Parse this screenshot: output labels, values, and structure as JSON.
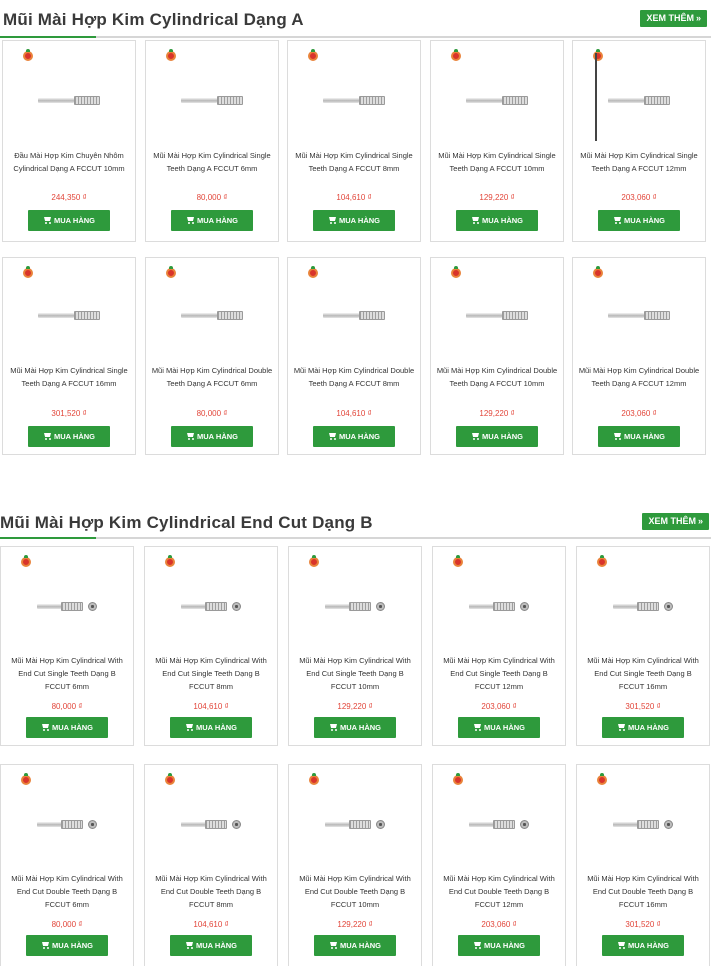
{
  "sections": [
    {
      "title": "Mũi Mài Hợp Kim Cylindrical Dạng A",
      "see_more": "XEM THÊM",
      "see_more_icon": "double-chevron-right",
      "products": [
        {
          "name": "Đầu Mài Hợp Kim Chuyên Nhôm Cylindrical Dạng A FCCUT 10mm",
          "price": "244,350 ₫",
          "buy": "MUA HÀNG"
        },
        {
          "name": "Mũi Mài Hợp Kim Cylindrical Single Teeth Dạng A FCCUT 6mm",
          "price": "80,000 ₫",
          "buy": "MUA HÀNG"
        },
        {
          "name": "Mũi Mài Hợp Kim Cylindrical Single Teeth Dạng A FCCUT 8mm",
          "price": "104,610 ₫",
          "buy": "MUA HÀNG"
        },
        {
          "name": "Mũi Mài Hợp Kim Cylindrical Single Teeth Dạng A FCCUT 10mm",
          "price": "129,220 ₫",
          "buy": "MUA HÀNG"
        },
        {
          "name": "Mũi Mài Hợp Kim Cylindrical Single Teeth Dạng A FCCUT 12mm",
          "price": "203,060 ₫",
          "buy": "MUA HÀNG"
        },
        {
          "name": "Mũi Mài Hợp Kim Cylindrical Single Teeth Dạng A FCCUT 16mm",
          "price": "301,520 ₫",
          "buy": "MUA HÀNG"
        },
        {
          "name": "Mũi Mài Hợp Kim Cylindrical Double Teeth Dạng A FCCUT 6mm",
          "price": "80,000 ₫",
          "buy": "MUA HÀNG"
        },
        {
          "name": "Mũi Mài Hợp Kim Cylindrical Double Teeth Dạng A FCCUT 8mm",
          "price": "104,610 ₫",
          "buy": "MUA HÀNG"
        },
        {
          "name": "Mũi Mài Hợp Kim Cylindrical Double Teeth Dạng A FCCUT 10mm",
          "price": "129,220 ₫",
          "buy": "MUA HÀNG"
        },
        {
          "name": "Mũi Mài Hợp Kim Cylindrical Double Teeth Dạng A FCCUT 12mm",
          "price": "203,060 ₫",
          "buy": "MUA HÀNG"
        }
      ]
    },
    {
      "title": "Mũi Mài Hợp Kim Cylindrical End Cut Dạng B",
      "see_more": "XEM THÊM",
      "see_more_icon": "double-chevron-right",
      "products": [
        {
          "name": "Mũi Mài Hợp Kim Cylindrical With End Cut Single Teeth Dạng B FCCUT 6mm",
          "price": "80,000 ₫",
          "buy": "MUA HÀNG"
        },
        {
          "name": "Mũi Mài Hợp Kim Cylindrical With End Cut Single Teeth Dạng B FCCUT 8mm",
          "price": "104,610 ₫",
          "buy": "MUA HÀNG"
        },
        {
          "name": "Mũi Mài Hợp Kim Cylindrical With End Cut Single Teeth Dạng B FCCUT 10mm",
          "price": "129,220 ₫",
          "buy": "MUA HÀNG"
        },
        {
          "name": "Mũi Mài Hợp Kim Cylindrical With End Cut Single Teeth Dạng B FCCUT 12mm",
          "price": "203,060 ₫",
          "buy": "MUA HÀNG"
        },
        {
          "name": "Mũi Mài Hợp Kim Cylindrical With End Cut Single Teeth Dạng B FCCUT 16mm",
          "price": "301,520 ₫",
          "buy": "MUA HÀNG"
        },
        {
          "name": "Mũi Mài Hợp Kim Cylindrical With End Cut Double Teeth Dạng B FCCUT 6mm",
          "price": "80,000 ₫",
          "buy": "MUA HÀNG"
        },
        {
          "name": "Mũi Mài Hợp Kim Cylindrical With End Cut Double Teeth Dạng B FCCUT 8mm",
          "price": "104,610 ₫",
          "buy": "MUA HÀNG"
        },
        {
          "name": "Mũi Mài Hợp Kim Cylindrical With End Cut Double Teeth Dạng B FCCUT 10mm",
          "price": "129,220 ₫",
          "buy": "MUA HÀNG"
        },
        {
          "name": "Mũi Mài Hợp Kim Cylindrical With End Cut Double Teeth Dạng B FCCUT 12mm",
          "price": "203,060 ₫",
          "buy": "MUA HÀNG"
        },
        {
          "name": "Mũi Mài Hợp Kim Cylindrical With End Cut Double Teeth Dạng B FCCUT 16mm",
          "price": "301,520 ₫",
          "buy": "MUA HÀNG"
        }
      ]
    }
  ],
  "colors": {
    "accent": "#2e9a3c",
    "price": "#e2463a",
    "title_text": "#3a3a3a"
  }
}
